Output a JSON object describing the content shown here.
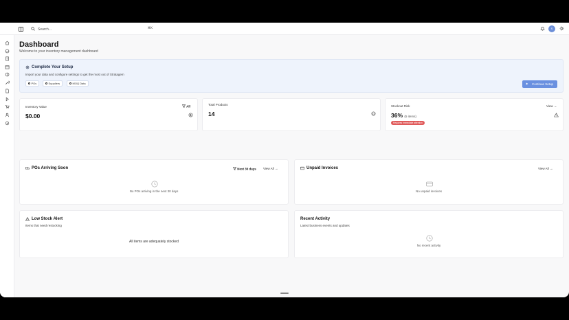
{
  "search": {
    "placeholder": "Search...",
    "shortcut": "⌘K"
  },
  "user": {
    "initial": "S"
  },
  "brand": {
    "accent": "#6a90e0",
    "logo_color": "#b32418",
    "risk_color": "#e05a5a"
  },
  "header": {
    "title": "Dashboard",
    "subtitle": "Welcome to your inventory management dashboard"
  },
  "setup": {
    "title": "Complete Your Setup",
    "description": "Import your data and configure settings to get the most out of Stratagem",
    "chips": [
      "POs",
      "Suppliers",
      "MOQ Data"
    ],
    "button": "Continue Setup"
  },
  "stats": {
    "inventory": {
      "label": "Inventory Value",
      "value": "$0.00",
      "filter": "All"
    },
    "products": {
      "label": "Total Products",
      "value": "14"
    },
    "stockout": {
      "label": "Stockout Risk",
      "value": "36%",
      "detail": "(5 items)",
      "view": "View →",
      "badge": "Requires immediate attention"
    }
  },
  "pos": {
    "title": "POs Arriving Soon",
    "filter": "Next 30 days",
    "view_all": "View All",
    "empty": "No POs arriving in the next 30 days"
  },
  "invoices": {
    "title": "Unpaid Invoices",
    "view_all": "View All",
    "empty": "No unpaid invoices"
  },
  "low_stock": {
    "title": "Low Stock Alert",
    "subtitle": "Items that need restocking",
    "empty": "All items are adequately stocked"
  },
  "activity": {
    "title": "Recent Activity",
    "subtitle": "Latest business events and updates",
    "empty": "No recent activity"
  },
  "sidebar_icons": [
    "home-icon",
    "package-icon",
    "document-icon",
    "box-icon",
    "truck-icon",
    "wrench-icon",
    "file-icon",
    "play-icon",
    "cart-icon",
    "users-icon",
    "settings-icon"
  ]
}
